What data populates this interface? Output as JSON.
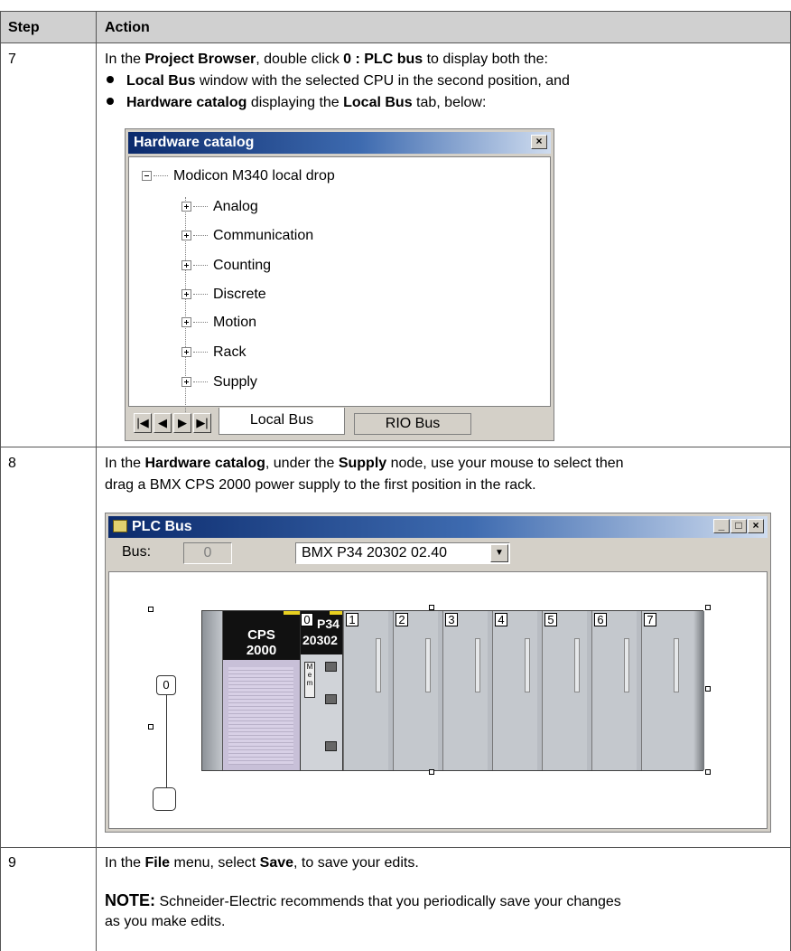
{
  "table": {
    "header_step": "Step",
    "header_action": "Action"
  },
  "row7": {
    "step": "7",
    "line1_pre": "In the ",
    "line1_b1": "Project Browser",
    "line1_mid": ", double click ",
    "line1_b2": "0 : PLC bus",
    "line1_post": " to display both the:",
    "bullet1_b": "Local Bus",
    "bullet1_post": " window with the selected CPU in the second position, and",
    "bullet2_b1": "Hardware catalog",
    "bullet2_mid": " displaying the ",
    "bullet2_b2": "Local Bus",
    "bullet2_post": " tab, below:"
  },
  "hardware_catalog": {
    "title": "Hardware catalog",
    "close": "×",
    "root": "Modicon M340 local drop",
    "items": [
      "Analog",
      "Communication",
      "Counting",
      "Discrete",
      "Motion",
      "Rack",
      "Supply"
    ],
    "nav": [
      "|◀",
      "◀",
      "▶",
      "▶|"
    ],
    "tab_active": "Local Bus",
    "tab_inactive": "RIO Bus"
  },
  "row8": {
    "step": "8",
    "line1_pre": "In the ",
    "line1_b1": "Hardware catalog",
    "line1_mid": ", under the ",
    "line1_b2": "Supply",
    "line1_post": " node, use your mouse to select then",
    "line2": "drag a BMX CPS 2000 power supply to the first position in the rack."
  },
  "plc_bus": {
    "title": "PLC Bus",
    "bus_label": "Bus:",
    "bus_value": "0",
    "cpu_select": "BMX P34 20302 02.40",
    "cps_line1": "CPS",
    "cps_line2": "2000",
    "cpu_line1": "P34",
    "cpu_line2": "20302",
    "cpu_slot": "0",
    "mem_label": "M\ne\nm",
    "slots": [
      "1",
      "2",
      "3",
      "4",
      "5",
      "6",
      "7"
    ],
    "bus_node": "0",
    "win_buttons": [
      "_",
      "□",
      "×"
    ]
  },
  "row9": {
    "step": "9",
    "line1_pre": "In the ",
    "line1_b1": "File",
    "line1_mid": " menu, select ",
    "line1_b2": "Save",
    "line1_post": ", to save your edits.",
    "note_label": "NOTE:",
    "note_line1": " Schneider-Electric recommends that you periodically save your changes",
    "note_line2": "as you make edits."
  }
}
